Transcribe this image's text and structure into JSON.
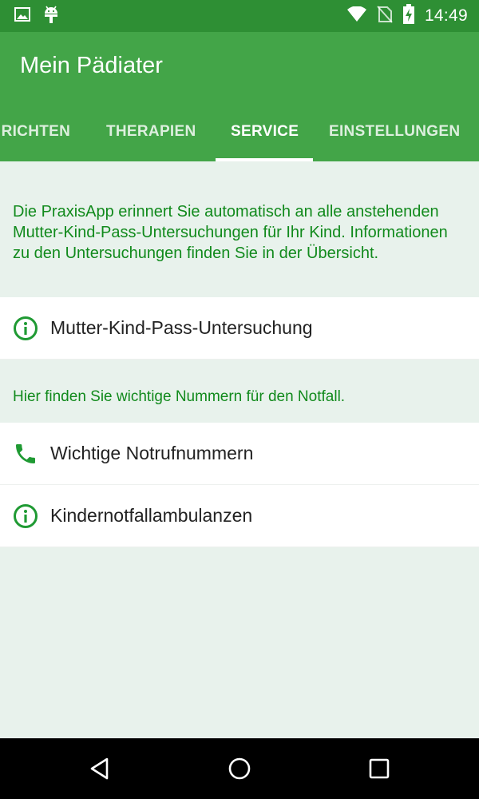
{
  "status_bar": {
    "time": "14:49",
    "icons": [
      "image-icon",
      "android-icon",
      "wifi-icon",
      "no-sim-icon",
      "battery-charging-icon"
    ]
  },
  "app_bar": {
    "title": "Mein Pädiater",
    "tabs": [
      {
        "label": "IRICHTEN"
      },
      {
        "label": "THERAPIEN"
      },
      {
        "label": "SERVICE",
        "active": true
      },
      {
        "label": "EINSTELLUNGEN"
      }
    ]
  },
  "main": {
    "intro_text": "Die PraxisApp erinnert Sie automatisch an alle anstehenden Mutter-Kind-Pass-Untersuchungen für Ihr Kind. Informationen zu den Untersuchungen finden Sie in der Übersicht.",
    "mkp_item": {
      "label": "Mutter-Kind-Pass-Untersuchung",
      "icon": "info-icon"
    },
    "notfall_text": "Hier finden Sie wichtige Nummern für den Notfall.",
    "emergency_items": [
      {
        "label": "Wichtige Notrufnummern",
        "icon": "phone-icon"
      },
      {
        "label": "Kindernotfallambulanzen",
        "icon": "info-icon"
      }
    ]
  },
  "nav_bar": {
    "buttons": [
      "back-icon",
      "home-icon",
      "recents-icon"
    ]
  },
  "colors": {
    "status_bar": "#2e8f34",
    "app_bar": "#43a548",
    "accent_green": "#118a1c",
    "background": "#e8f2ec"
  }
}
